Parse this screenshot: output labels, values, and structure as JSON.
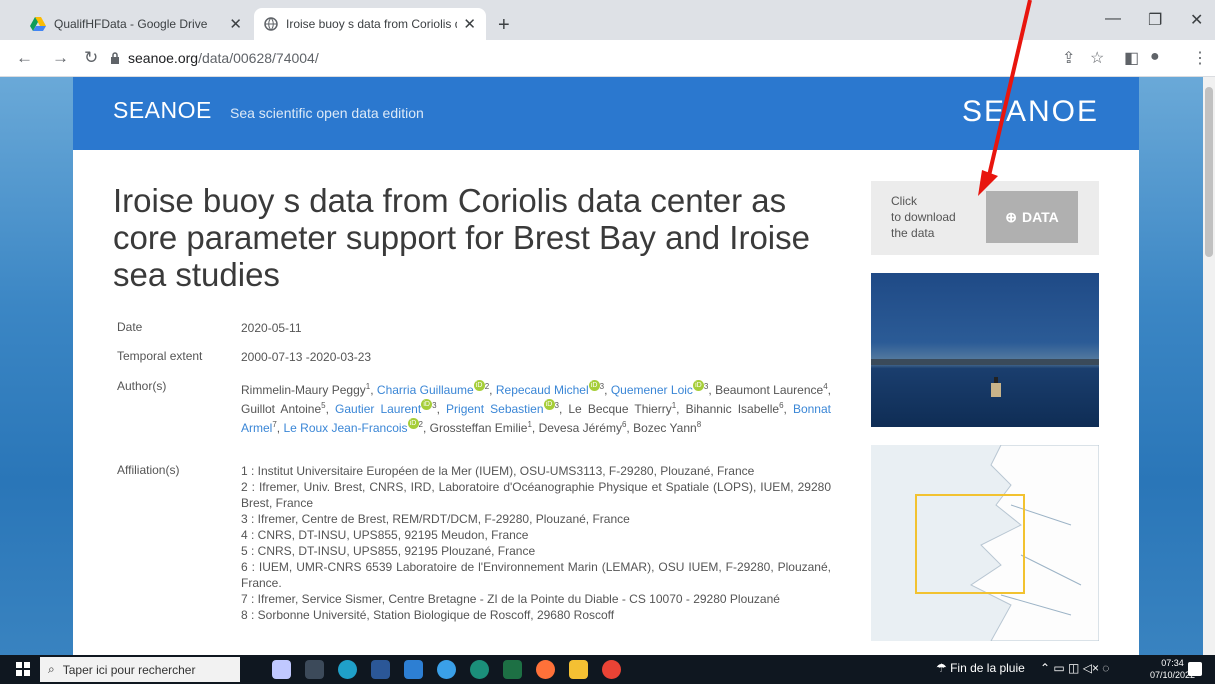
{
  "browser": {
    "tabs": [
      {
        "title": "QualifHFData - Google Drive"
      },
      {
        "title": "Iroise buoy s data from Coriolis data cen"
      }
    ],
    "url_host": "seanoe.org",
    "url_path": "/data/00628/74004/"
  },
  "site": {
    "brand": "SEANOE",
    "tagline": "Sea scientific open data edition",
    "logo": "SEANOE"
  },
  "dataset": {
    "title": "Iroise buoy s data from Coriolis data center as core parameter support for Brest Bay and Iroise sea studies",
    "date_label": "Date",
    "date": "2020-05-11",
    "extent_label": "Temporal extent",
    "extent": "2000-07-13 -2020-03-23",
    "authors_label": "Author(s)",
    "affiliation_label": "Affiliation(s)",
    "affiliations": [
      "1 : Institut Universitaire Européen de la Mer (IUEM), OSU-UMS3113, F-29280, Plouzané, France",
      "2 : Ifremer, Univ. Brest, CNRS, IRD, Laboratoire d'Océanographie Physique et Spatiale (LOPS), IUEM, 29280 Brest, France",
      "3 : Ifremer, Centre de Brest, REM/RDT/DCM, F-29280, Plouzané, France",
      "4 : CNRS, DT-INSU, UPS855, 92195 Meudon, France",
      "5 : CNRS, DT-INSU, UPS855, 92195 Plouzané, France",
      "6 : IUEM, UMR-CNRS 6539 Laboratoire de l'Environnement Marin (LEMAR), OSU IUEM, F-29280, Plouzané, France.",
      "7 : Ifremer, Service Sismer, Centre Bretagne - ZI de la Pointe du Diable - CS 10070 - 29280 Plouzané",
      "8 : Sorbonne Université, Station Biologique de Roscoff, 29680 Roscoff"
    ]
  },
  "download": {
    "hint_line1": "Click",
    "hint_line2": "to download",
    "hint_line3": "the data",
    "button": "DATA"
  },
  "taskbar": {
    "search_placeholder": "Taper ici pour rechercher",
    "weather": "Fin de la pluie",
    "time": "07:34",
    "date": "07/10/2022"
  },
  "colors": {
    "banner": "#2b78cf",
    "link": "#3a86d6",
    "annotation_arrow": "#e8150e"
  }
}
